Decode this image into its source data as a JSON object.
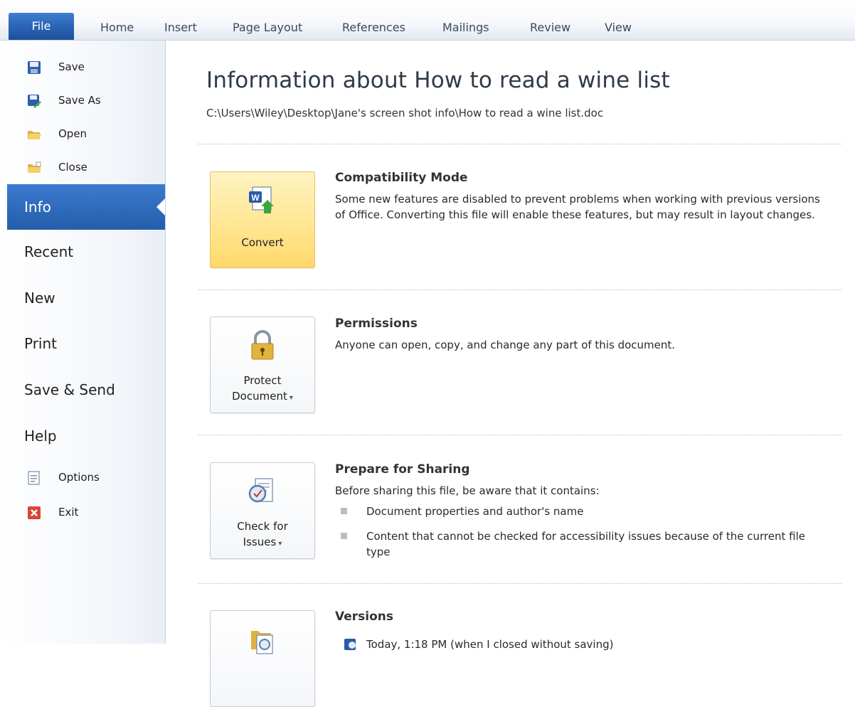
{
  "ribbon": {
    "tabs": [
      "File",
      "Home",
      "Insert",
      "Page Layout",
      "References",
      "Mailings",
      "Review",
      "View"
    ],
    "active_tab": "File"
  },
  "backstage": {
    "commands": [
      {
        "label": "Save",
        "icon": "save-icon"
      },
      {
        "label": "Save As",
        "icon": "save-as-icon"
      },
      {
        "label": "Open",
        "icon": "open-folder-icon"
      },
      {
        "label": "Close",
        "icon": "close-folder-icon"
      }
    ],
    "nav": [
      "Info",
      "Recent",
      "New",
      "Print",
      "Save & Send",
      "Help"
    ],
    "selected": "Info",
    "footer_commands": [
      {
        "label": "Options",
        "icon": "options-icon"
      },
      {
        "label": "Exit",
        "icon": "exit-icon"
      }
    ]
  },
  "info": {
    "title": "Information about How to read a wine list",
    "path": "C:\\Users\\Wiley\\Desktop\\Jane's screen shot info\\How to read a wine list.doc",
    "sections": [
      {
        "button": {
          "line1": "Convert",
          "line2": "",
          "icon": "convert-document-icon"
        },
        "title": "Compatibility Mode",
        "body": "Some new features are disabled to prevent problems when working with previous versions of Office. Converting this file will enable these features, but may result in layout changes."
      },
      {
        "button": {
          "line1": "Protect",
          "line2": "Document",
          "icon": "padlock-keys-icon"
        },
        "title": "Permissions",
        "body": "Anyone can open, copy, and change any part of this document."
      },
      {
        "button": {
          "line1": "Check for",
          "line2": "Issues",
          "icon": "inspect-document-icon"
        },
        "title": "Prepare for Sharing",
        "body": "Before sharing this file, be aware that it contains:",
        "bullets": [
          "Document properties and author's name",
          "Content that cannot be checked for accessibility issues because of the current file type"
        ]
      },
      {
        "button": {
          "line1": "",
          "line2": "",
          "icon": "versions-icon"
        },
        "title": "Versions",
        "body": "Today, 1:18 PM (when I closed without saving)"
      }
    ]
  },
  "colors": {
    "file_tab": "#2a62b3",
    "nav_selected": "#245da8",
    "convert_button": "#ffe58f"
  }
}
